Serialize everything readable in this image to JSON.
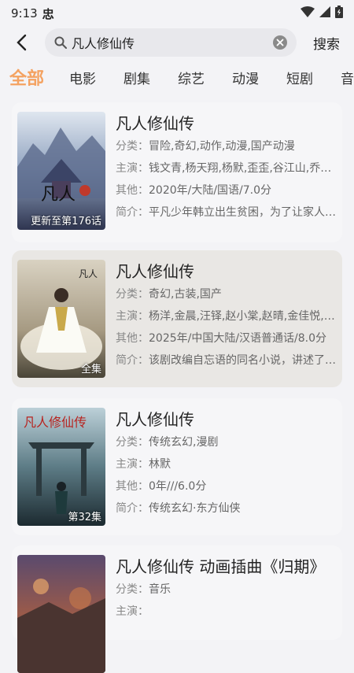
{
  "status": {
    "time": "9:13",
    "notif_glyph": "忠"
  },
  "search": {
    "value": "凡人修仙传",
    "submit_label": "搜索"
  },
  "tabs": [
    "全部",
    "电影",
    "剧集",
    "综艺",
    "动漫",
    "短剧",
    "音"
  ],
  "labels": {
    "genre": "分类：",
    "cast": "主演：",
    "other": "其他：",
    "intro": "简介："
  },
  "results": [
    {
      "title": "凡人修仙传",
      "genre": "冒险,奇幻,动作,动漫,国产动漫",
      "cast": "钱文青,杨天翔,杨默,歪歪,谷江山,乔诗语",
      "other": "2020年/大陆/国语/7.0分",
      "intro": "平凡少年韩立出生贫困，为了让家人过上更好的生活",
      "badge": "更新至第176话"
    },
    {
      "title": "凡人修仙传",
      "genre": "奇幻,古装,国产",
      "cast": "杨洋,金晨,汪铎,赵小棠,赵晴,金佳悦,王鹤润",
      "other": "2025年/中国大陆/汉语普通话/8.0分",
      "intro": "该剧改编自忘语的同名小说，讲述了韩立的故事",
      "badge": "全集"
    },
    {
      "title": "凡人修仙传",
      "genre": "传统玄幻,漫剧",
      "cast": "林默",
      "other": "0年///6.0分",
      "intro": "传统玄幻·东方仙侠",
      "badge": "第32集"
    },
    {
      "title": "凡人修仙传 动画插曲《归期》",
      "genre": "音乐",
      "cast": "",
      "other": "",
      "intro": "",
      "badge": ""
    }
  ],
  "colors": {
    "accent": "#f4a261",
    "highlight_card": "#e9e7e4"
  }
}
